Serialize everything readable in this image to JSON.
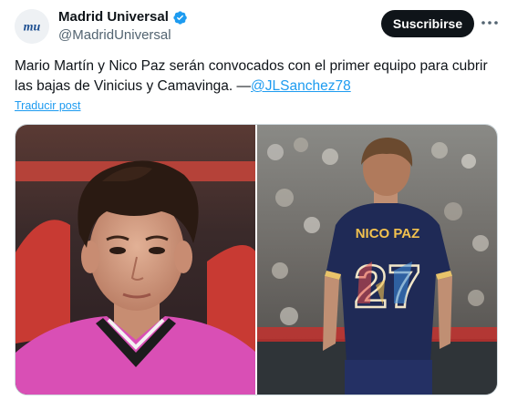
{
  "account": {
    "display_name": "Madrid Universal",
    "handle": "@MadridUniversal",
    "avatar_text": "mu"
  },
  "actions": {
    "follow_label": "Suscribirse",
    "more_label": "···"
  },
  "tweet": {
    "text": "Mario Martín y Nico Paz serán convocados con el primer equipo para cubrir las bajas de Vinicius y Camavinga. —",
    "mention": "@JLSanchez78",
    "translate_label": "Traducir post"
  },
  "media": {
    "images": [
      {
        "description_icon": "player-portrait-photo"
      },
      {
        "description_icon": "player-back-photo",
        "jersey_name": "NICO PAZ",
        "jersey_number": "27"
      }
    ]
  },
  "colors": {
    "accent": "#1d9bf0",
    "button_bg": "#0f1419",
    "handle_gray": "#536471",
    "verified_blue": "#1d9bf0"
  }
}
